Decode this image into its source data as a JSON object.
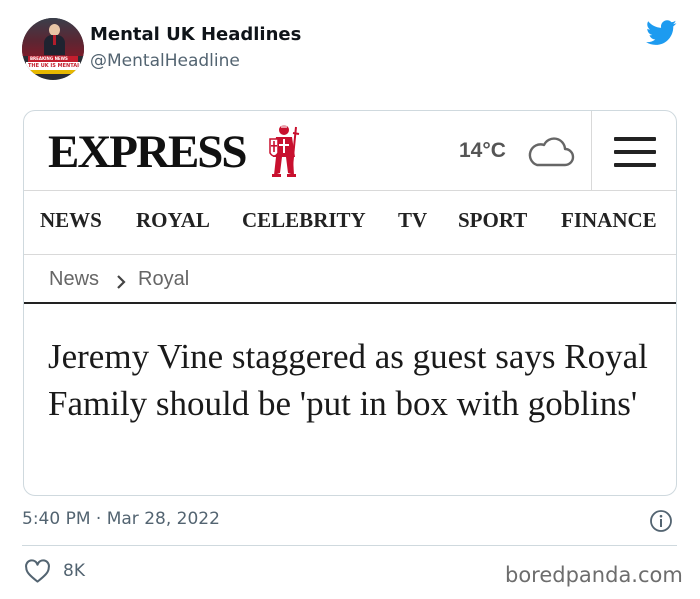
{
  "tweet": {
    "user_name": "Mental UK Headlines",
    "user_handle": "@MentalHeadline",
    "avatar_text": [
      "BREAKING NEWS",
      "THE UK IS MENTAL"
    ],
    "timestamp": "5:40 PM · Mar 28, 2022",
    "like_count": "8K",
    "brand_color": "#1d9bf0",
    "icons": [
      "twitter-bird-icon",
      "info-icon",
      "heart-icon"
    ]
  },
  "express": {
    "logo": "EXPRESS",
    "temperature": "14°C",
    "nav": [
      "NEWS",
      "ROYAL",
      "CELEBRITY",
      "TV",
      "SPORT",
      "FINANCE"
    ],
    "breadcrumb": [
      "News",
      "Royal"
    ],
    "headline": "Jeremy Vine staggered as guest says Royal Family should be 'put in box with goblins'",
    "accent_color": "#c8102e",
    "icons": [
      "crusader-icon",
      "cloud-icon",
      "menu-icon",
      "chevron-right-icon"
    ]
  },
  "watermark": "boredpanda.com"
}
